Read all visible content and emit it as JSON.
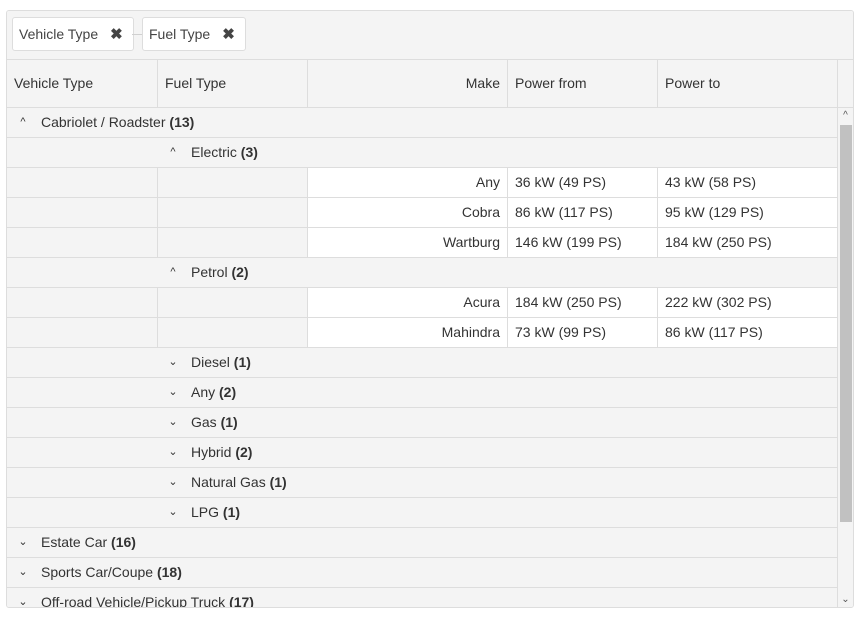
{
  "grouping": {
    "chips": [
      {
        "label": "Vehicle Type",
        "remove_icon": "close-icon"
      },
      {
        "label": "Fuel Type",
        "remove_icon": "close-icon"
      }
    ]
  },
  "columns": [
    "Vehicle Type",
    "Fuel Type",
    "Make",
    "Power from",
    "Power to"
  ],
  "rows": [
    {
      "type": "group",
      "level": 0,
      "expanded": true,
      "label": "Cabriolet / Roadster",
      "count": "(13)"
    },
    {
      "type": "group",
      "level": 1,
      "expanded": true,
      "label": "Electric",
      "count": "(3)"
    },
    {
      "type": "data",
      "make": "Any",
      "power_from": "36 kW (49 PS)",
      "power_to": "43 kW (58 PS)"
    },
    {
      "type": "data",
      "make": "Cobra",
      "power_from": "86 kW (117 PS)",
      "power_to": "95 kW (129 PS)"
    },
    {
      "type": "data",
      "make": "Wartburg",
      "power_from": "146 kW (199 PS)",
      "power_to": "184 kW (250 PS)"
    },
    {
      "type": "group",
      "level": 1,
      "expanded": true,
      "label": "Petrol",
      "count": "(2)"
    },
    {
      "type": "data",
      "make": "Acura",
      "power_from": "184 kW (250 PS)",
      "power_to": "222 kW (302 PS)"
    },
    {
      "type": "data",
      "make": "Mahindra",
      "power_from": "73 kW (99 PS)",
      "power_to": "86 kW (117 PS)"
    },
    {
      "type": "group",
      "level": 1,
      "expanded": false,
      "label": "Diesel",
      "count": "(1)"
    },
    {
      "type": "group",
      "level": 1,
      "expanded": false,
      "label": "Any",
      "count": "(2)"
    },
    {
      "type": "group",
      "level": 1,
      "expanded": false,
      "label": "Gas",
      "count": "(1)"
    },
    {
      "type": "group",
      "level": 1,
      "expanded": false,
      "label": "Hybrid",
      "count": "(2)"
    },
    {
      "type": "group",
      "level": 1,
      "expanded": false,
      "label": "Natural Gas",
      "count": "(1)"
    },
    {
      "type": "group",
      "level": 1,
      "expanded": false,
      "label": "LPG",
      "count": "(1)"
    },
    {
      "type": "group",
      "level": 0,
      "expanded": false,
      "label": "Estate Car",
      "count": "(16)"
    },
    {
      "type": "group",
      "level": 0,
      "expanded": false,
      "label": "Sports Car/Coupe",
      "count": "(18)"
    },
    {
      "type": "group",
      "level": 0,
      "expanded": false,
      "label": "Off-road Vehicle/Pickup Truck",
      "count": "(17)"
    }
  ],
  "icons": {
    "expanded": "^",
    "collapsed": "⌄",
    "remove": "✖",
    "scroll_up": "^",
    "scroll_down": "⌄"
  }
}
